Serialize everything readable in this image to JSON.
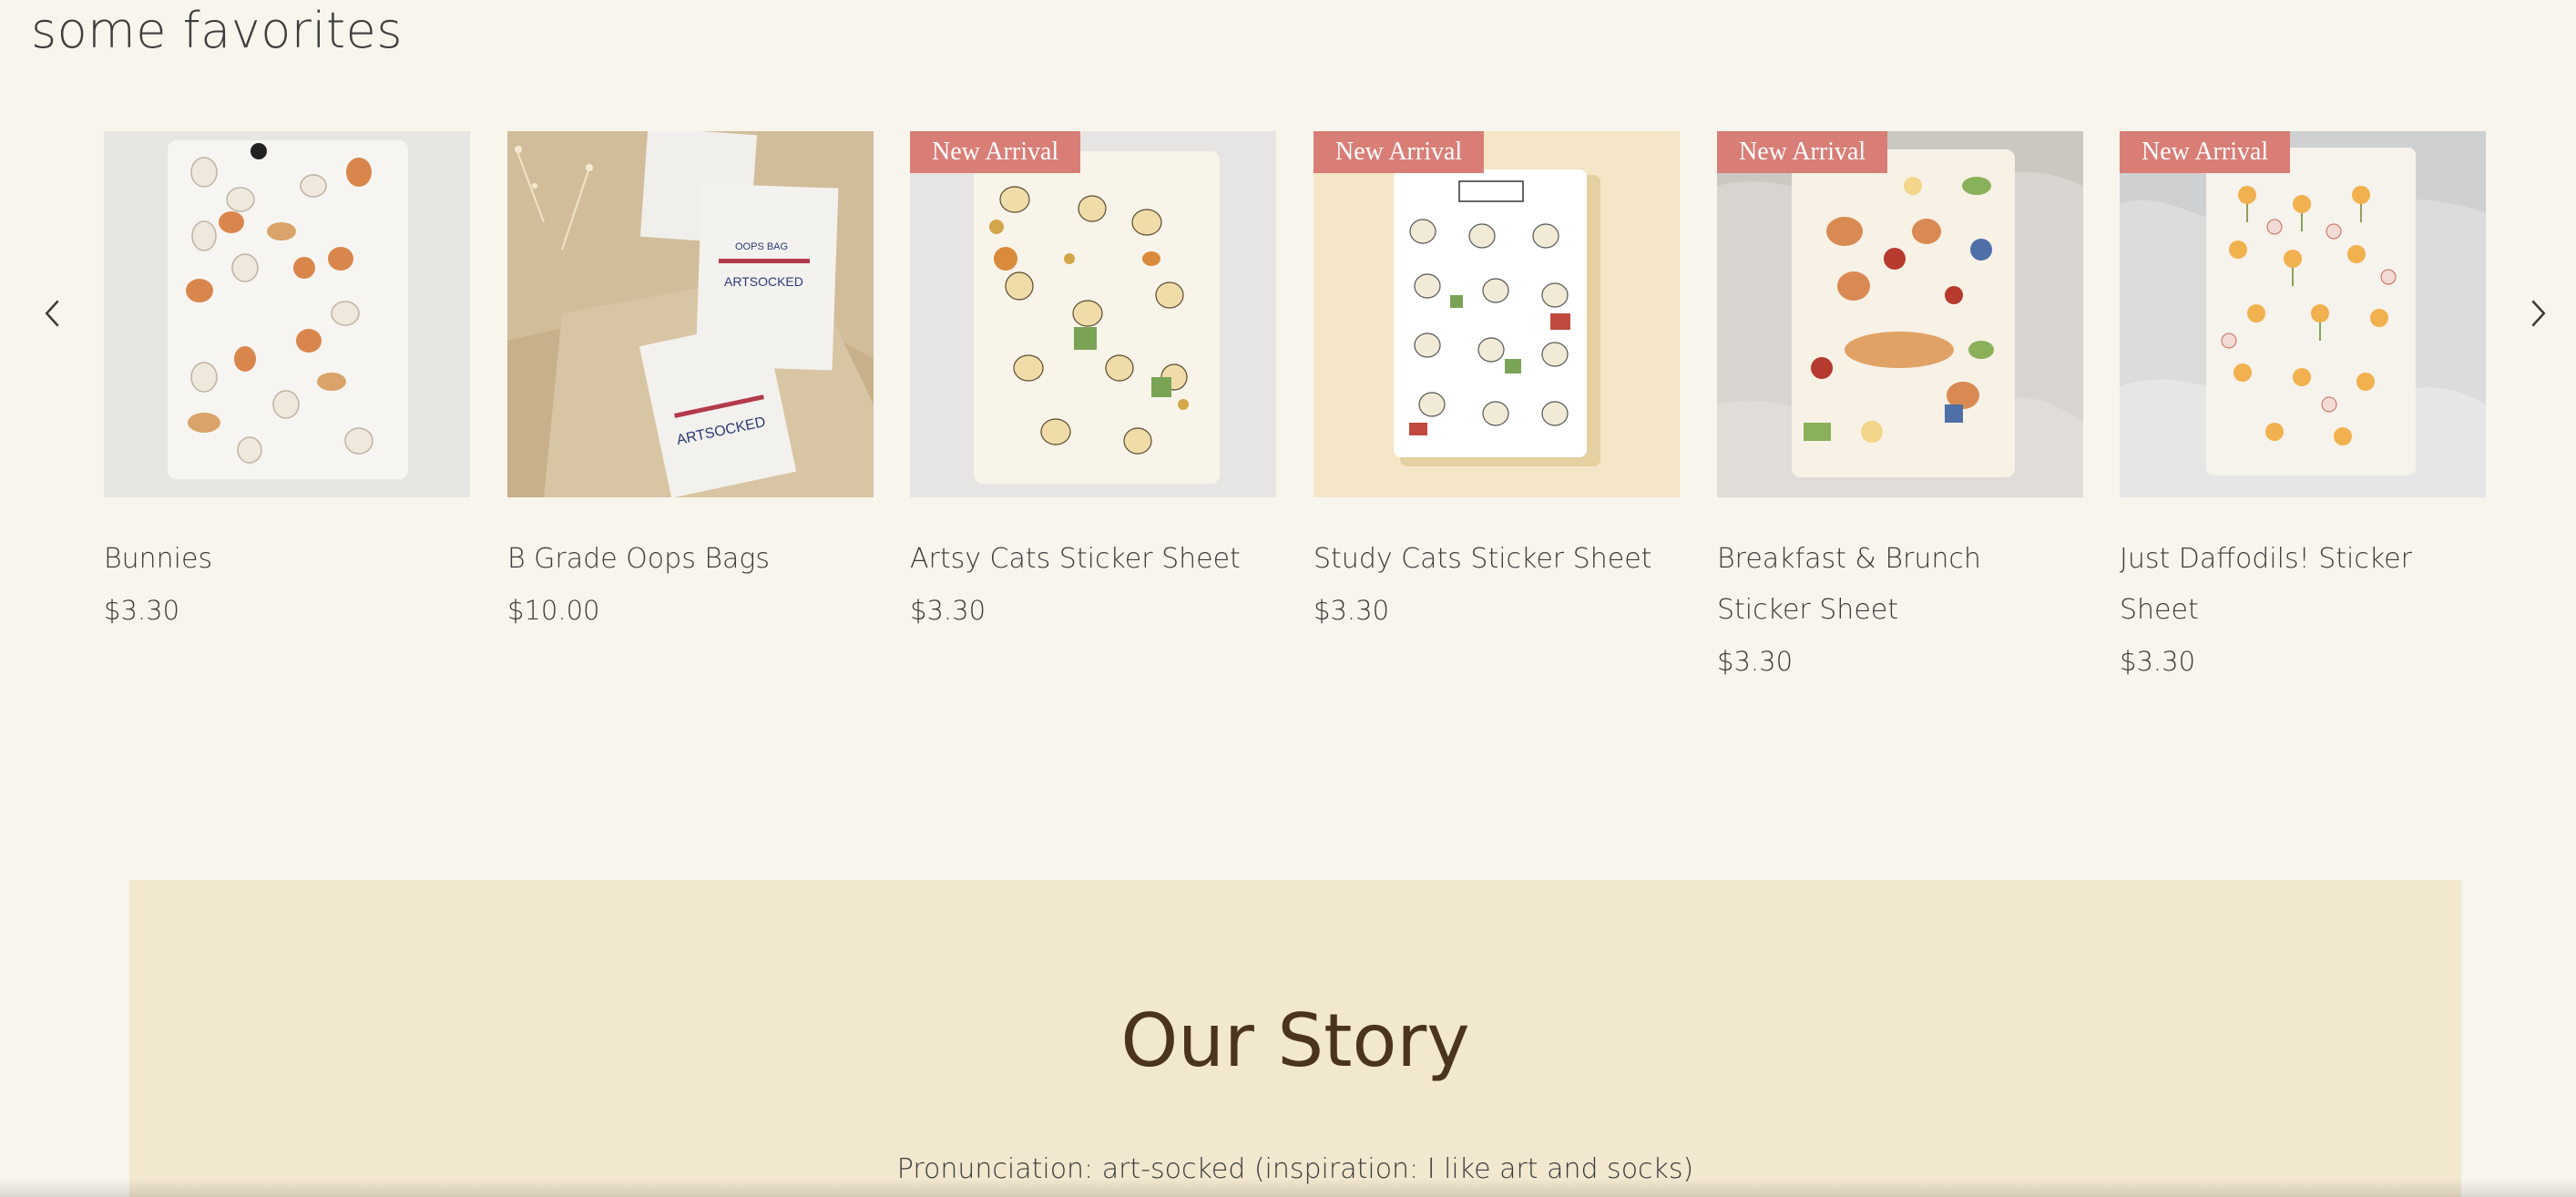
{
  "section": {
    "title": "some favorites"
  },
  "carousel": {
    "badge_text": "New Arrival",
    "products": [
      {
        "name": "Bunnies",
        "price": "$3.30",
        "badge": false,
        "image": "bunny-sticker-sheet"
      },
      {
        "name": "B Grade Oops Bags",
        "price": "$10.00",
        "badge": false,
        "image": "oops-bags"
      },
      {
        "name": "Artsy Cats Sticker Sheet",
        "price": "$3.30",
        "badge": true,
        "image": "artsy-cats-sheet"
      },
      {
        "name": "Study Cats Sticker Sheet",
        "price": "$3.30",
        "badge": true,
        "image": "study-cats-sheet"
      },
      {
        "name": "Breakfast & Brunch Sticker Sheet",
        "price": "$3.30",
        "badge": true,
        "image": "breakfast-brunch-sheet"
      },
      {
        "name": "Just Daffodils! Sticker Sheet",
        "price": "$3.30",
        "badge": true,
        "image": "daffodils-sheet"
      }
    ]
  },
  "story": {
    "title": "Our Story",
    "text": "Pronunciation: art-socked (inspiration: I like art and socks)"
  },
  "icons": {
    "prev": "chevron-left-icon",
    "next": "chevron-right-icon"
  },
  "colors": {
    "badge": "#d87e77",
    "story_bg": "#f2e7cf",
    "page_bg": "#f8f5ec",
    "story_title": "#4a3420"
  }
}
